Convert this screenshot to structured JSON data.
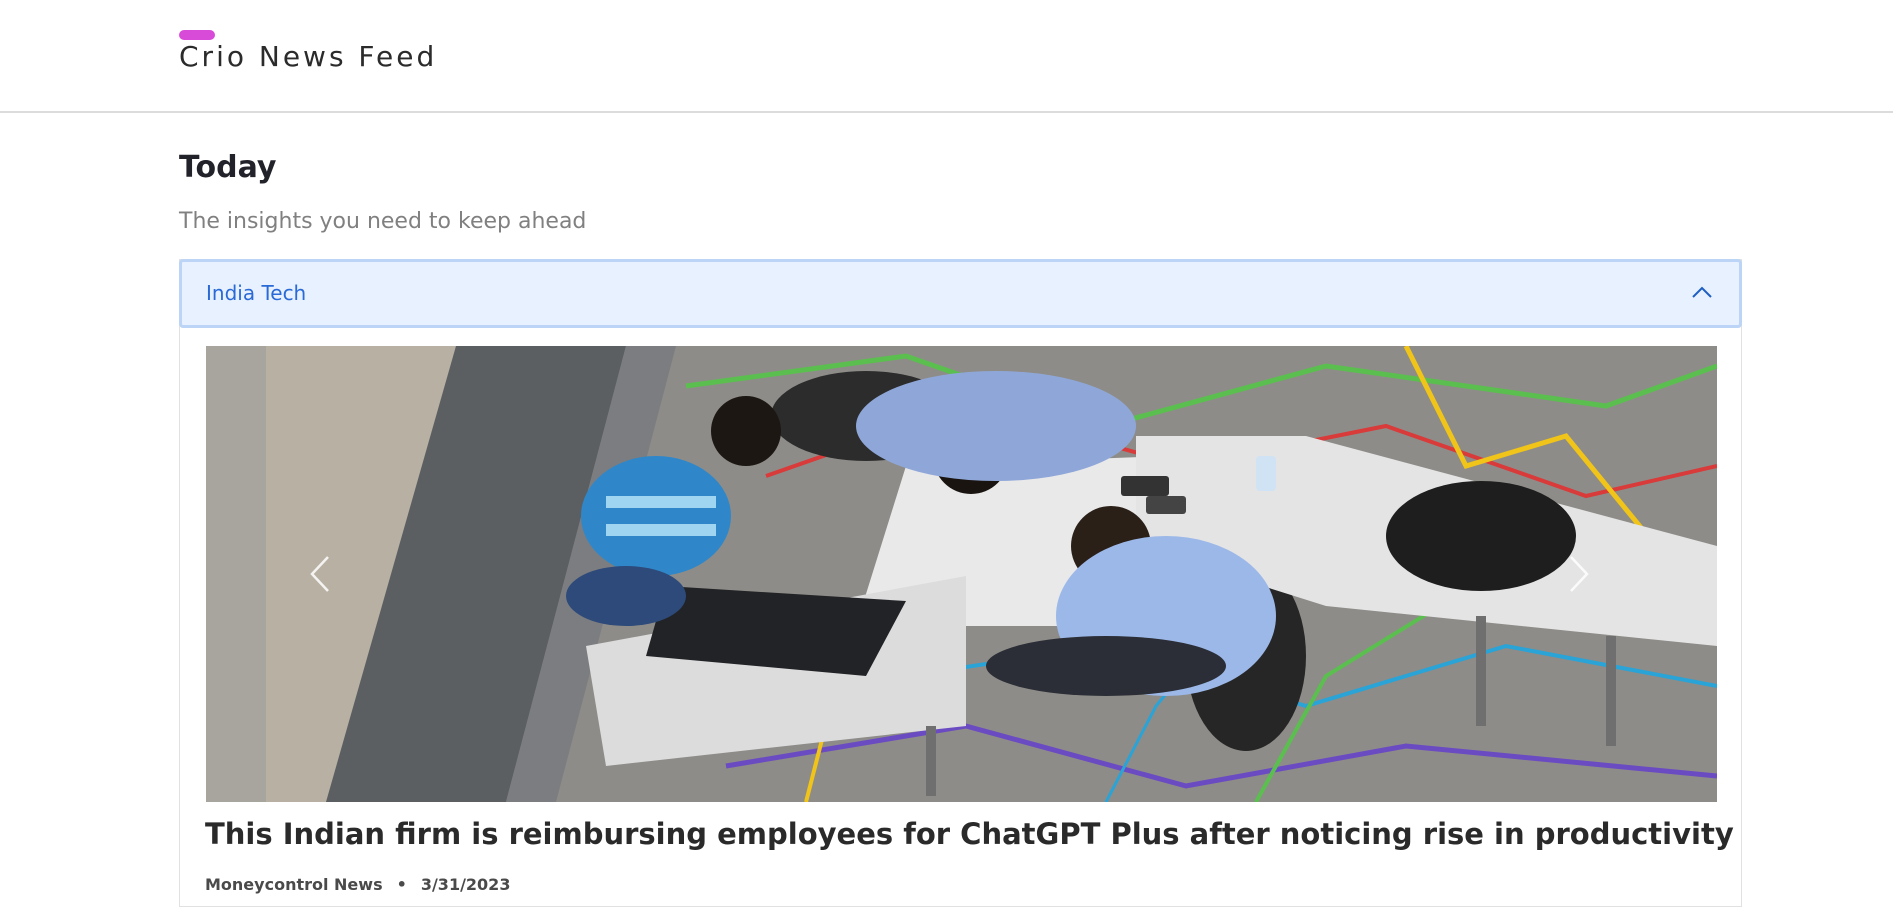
{
  "navbar": {
    "brand_title": "Crio News Feed",
    "brand_accent_color": "#d84bd8"
  },
  "page": {
    "heading": "Today",
    "subheading": "The insights you need to keep ahead"
  },
  "accordion": {
    "label": "India Tech",
    "expanded": true,
    "header_bg": "#e7f1ff",
    "label_color": "#2a6ad6",
    "toggle_icon": "chevron-up-icon"
  },
  "carousel": {
    "image_description_icon": "article-image",
    "prev_icon": "chevron-left-icon",
    "next_icon": "chevron-right-icon"
  },
  "article": {
    "title": "This Indian firm is reimbursing employees for ChatGPT Plus after noticing rise in productivity",
    "source": "Moneycontrol News",
    "separator": "•",
    "date": "3/31/2023"
  }
}
